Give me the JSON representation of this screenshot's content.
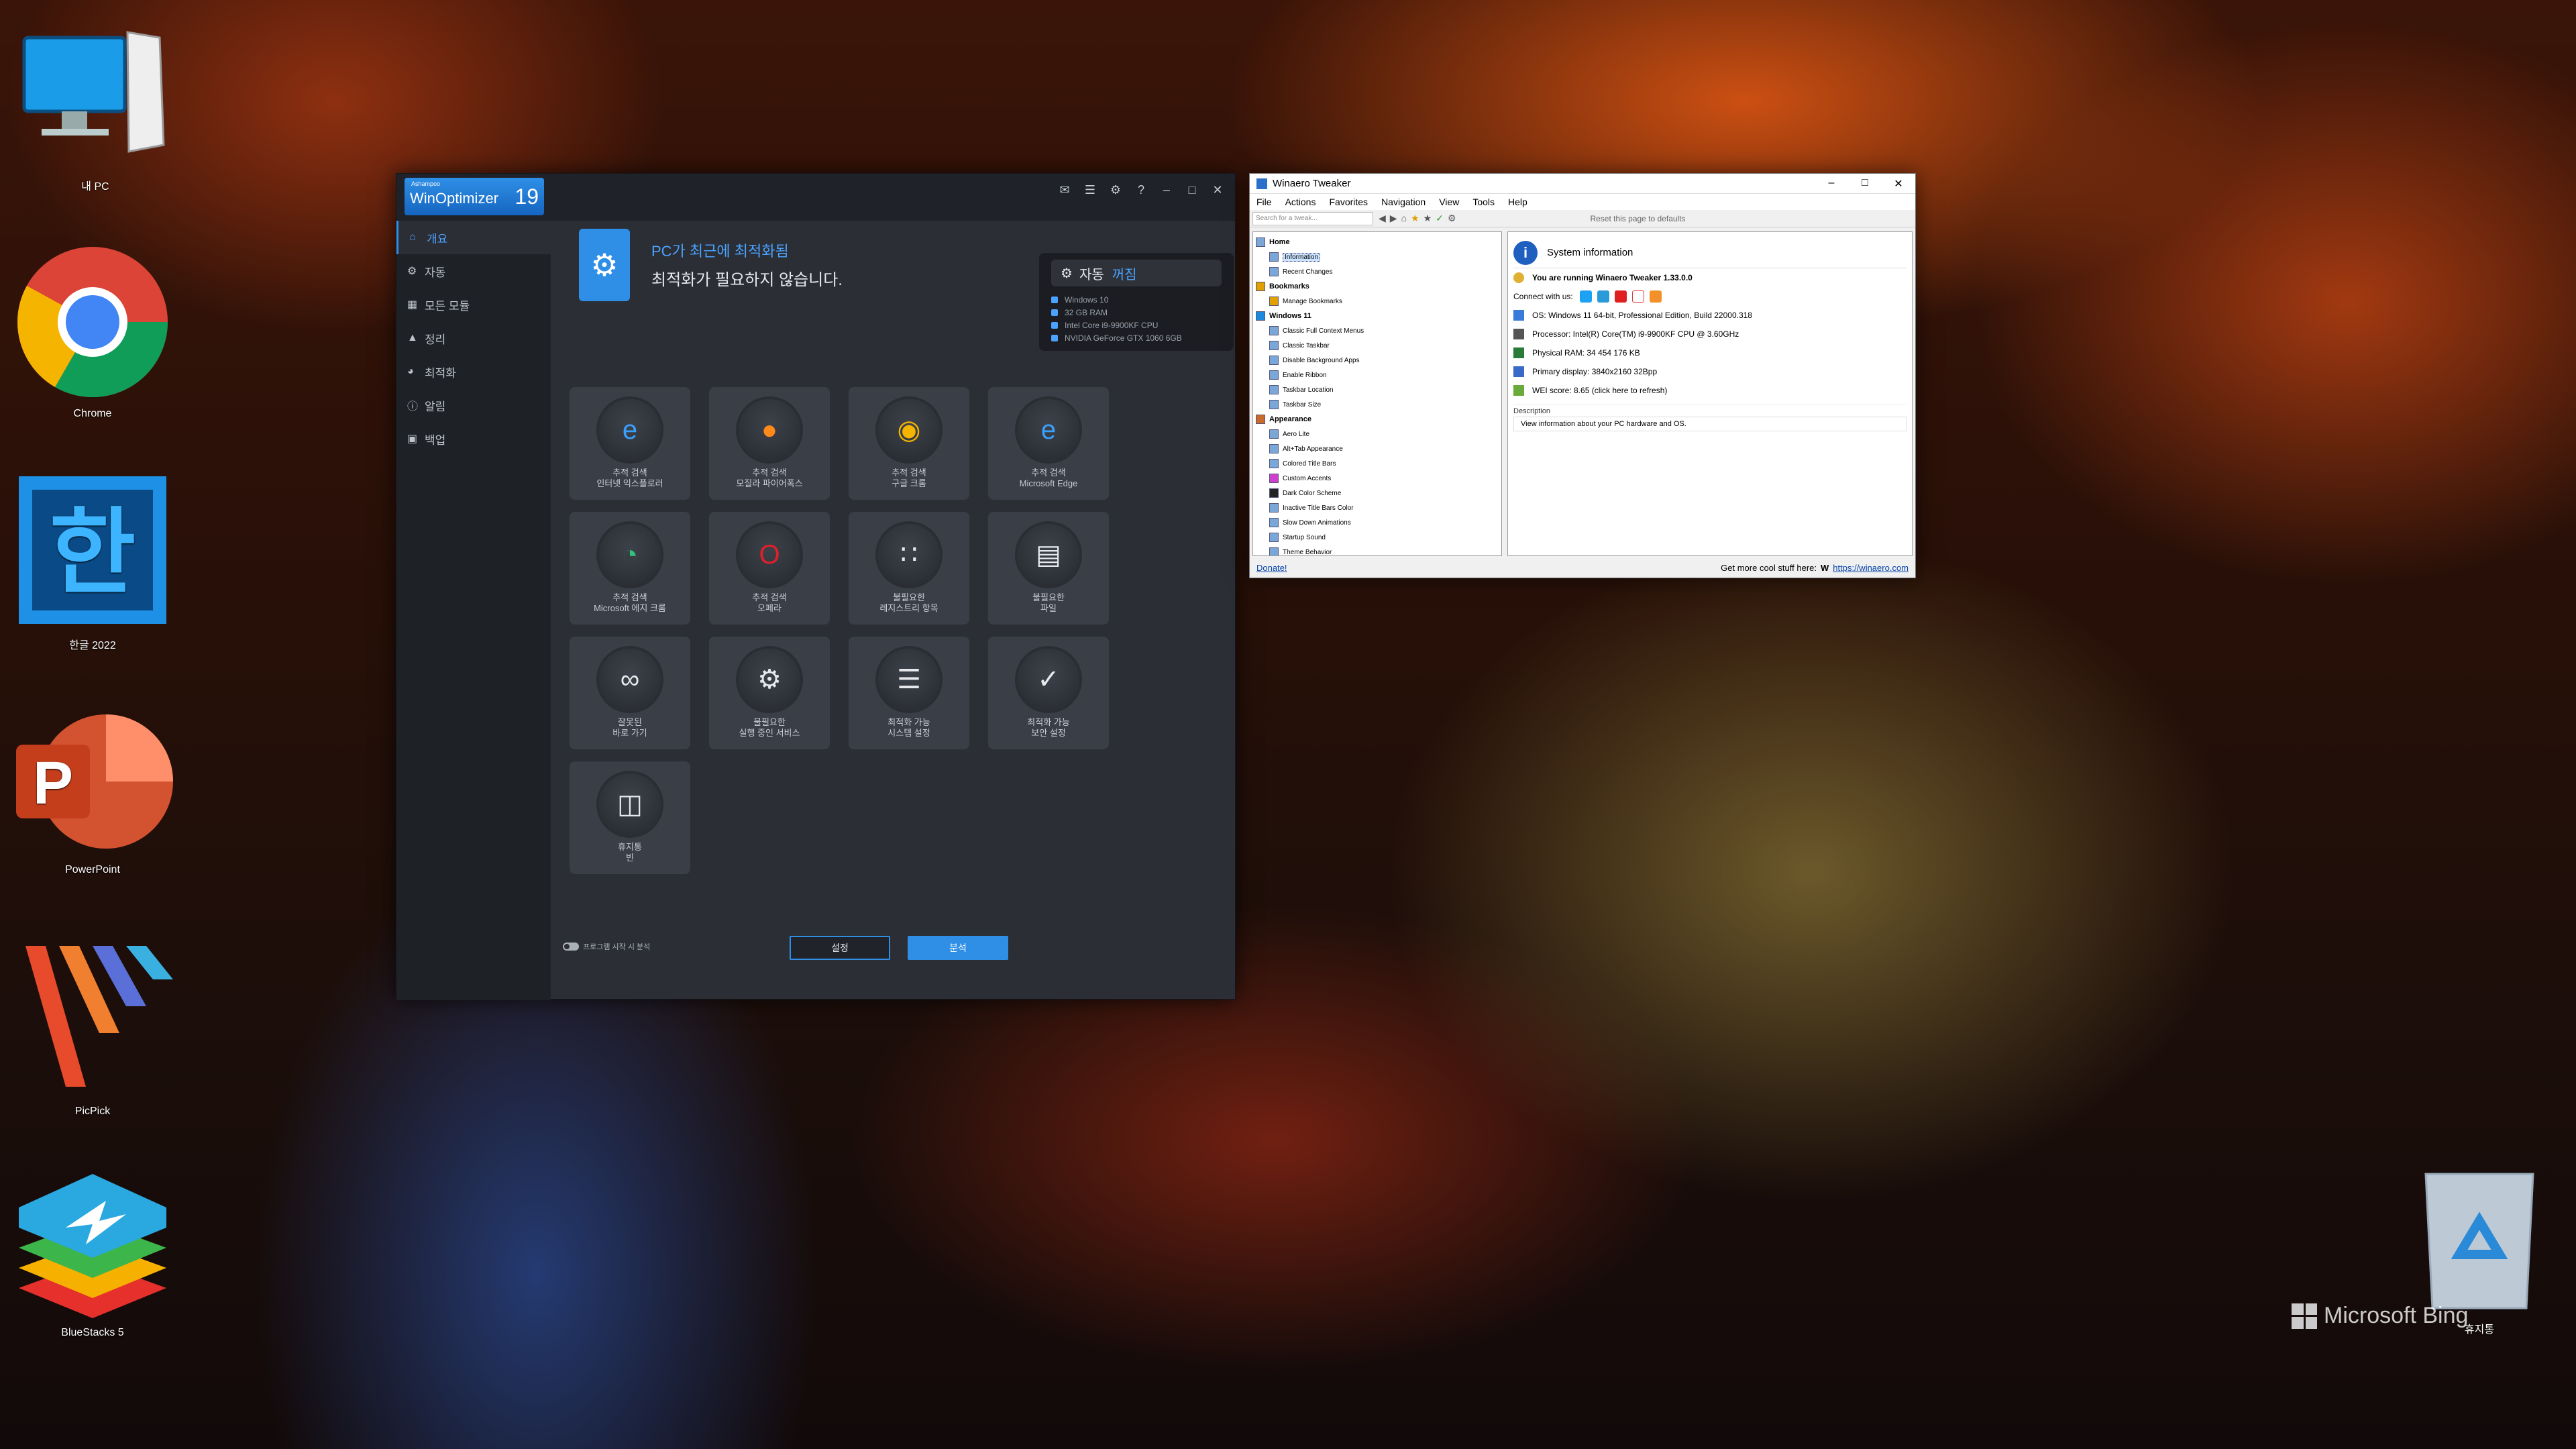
{
  "desktop": {
    "icons": [
      {
        "label": "내 PC",
        "icon": "computer-icon"
      },
      {
        "label": "Chrome",
        "icon": "chrome-icon"
      },
      {
        "label": "한글 2022",
        "icon": "hangul-icon"
      },
      {
        "label": "PowerPoint",
        "icon": "powerpoint-icon"
      },
      {
        "label": "PicPick",
        "icon": "picpick-icon"
      },
      {
        "label": "BlueStacks 5",
        "icon": "bluestacks-icon"
      }
    ],
    "recycle_bin_label": "휴지통",
    "bing_label": "Microsoft Bing"
  },
  "winoptimizer": {
    "brand_small": "Ashampoo",
    "brand": "WinOptimizer",
    "version": "19",
    "nav": [
      {
        "label": "개요",
        "icon": "home-icon",
        "active": true
      },
      {
        "label": "자동",
        "icon": "gears-icon"
      },
      {
        "label": "모든 모듈",
        "icon": "grid-icon"
      },
      {
        "label": "정리",
        "icon": "broom-icon"
      },
      {
        "label": "최적화",
        "icon": "speedometer-icon"
      },
      {
        "label": "알림",
        "icon": "info-icon"
      },
      {
        "label": "백업",
        "icon": "backup-icon"
      }
    ],
    "header": {
      "status_line": "PC가 최근에 최적화됨",
      "message": "최적화가 필요하지 않습니다."
    },
    "sys_panel": {
      "auto_label": "자동",
      "auto_state": "꺼짐",
      "items": [
        "Windows 10",
        "32 GB RAM",
        "Intel Core i9-9900KF CPU",
        "NVIDIA GeForce GTX 1060 6GB"
      ]
    },
    "tiles": [
      {
        "l1": "추적 검색",
        "l2": "인터넷 익스플로러",
        "icon": "ie-icon"
      },
      {
        "l1": "추적 검색",
        "l2": "모질라 파이어폭스",
        "icon": "firefox-icon"
      },
      {
        "l1": "추적 검색",
        "l2": "구글 크롬",
        "icon": "chrome-icon"
      },
      {
        "l1": "추적 검색",
        "l2": "Microsoft Edge",
        "icon": "edge-legacy-icon"
      },
      {
        "l1": "추적 검색",
        "l2": "Microsoft 에지 크롬",
        "icon": "edge-icon"
      },
      {
        "l1": "추적 검색",
        "l2": "오페라",
        "icon": "opera-icon"
      },
      {
        "l1": "불필요한",
        "l2": "레지스트리 항목",
        "icon": "registry-icon"
      },
      {
        "l1": "불필요한",
        "l2": "파일",
        "icon": "file-icon"
      },
      {
        "l1": "잘못된",
        "l2": "바로 가기",
        "icon": "link-icon"
      },
      {
        "l1": "불필요한",
        "l2": "실행 중인 서비스",
        "icon": "services-icon"
      },
      {
        "l1": "최적화 가능",
        "l2": "시스템 설정",
        "icon": "sliders-icon"
      },
      {
        "l1": "최적화 가능",
        "l2": "보안 설정",
        "icon": "shield-icon"
      },
      {
        "l1": "휴지통",
        "l2": "빈",
        "icon": "trash-icon"
      }
    ],
    "footer_toggle_label": "프로그램 시작 시 분석",
    "btn_settings": "설정",
    "btn_analyze": "분석"
  },
  "tweaker": {
    "title": "Winaero Tweaker",
    "menu": [
      "File",
      "Actions",
      "Favorites",
      "Navigation",
      "View",
      "Tools",
      "Help"
    ],
    "search_placeholder": "Search for a tweak...",
    "reset_label": "Reset this page to defaults",
    "tree": [
      {
        "label": "Home",
        "cat": true
      },
      {
        "label": "Information",
        "sel": true
      },
      {
        "label": "Recent Changes"
      },
      {
        "label": "Bookmarks",
        "cat": true
      },
      {
        "label": "Manage Bookmarks"
      },
      {
        "label": "Windows 11",
        "cat": true
      },
      {
        "label": "Classic Full Context Menus"
      },
      {
        "label": "Classic Taskbar"
      },
      {
        "label": "Disable Background Apps"
      },
      {
        "label": "Enable Ribbon"
      },
      {
        "label": "Taskbar Location"
      },
      {
        "label": "Taskbar Size"
      },
      {
        "label": "Appearance",
        "cat": true
      },
      {
        "label": "Aero Lite"
      },
      {
        "label": "Alt+Tab Appearance"
      },
      {
        "label": "Colored Title Bars"
      },
      {
        "label": "Custom Accents"
      },
      {
        "label": "Dark Color Scheme"
      },
      {
        "label": "Inactive Title Bars Color"
      },
      {
        "label": "Slow Down Animations"
      },
      {
        "label": "Startup Sound"
      },
      {
        "label": "Theme Behavior"
      }
    ],
    "detail": {
      "heading": "System information",
      "running": "You are running Winaero Tweaker 1.33.0.0",
      "connect": "Connect with us:",
      "os": "OS: Windows 11 64-bit, Professional Edition, Build 22000.318",
      "cpu": "Processor: Intel(R) Core(TM) i9-9900KF CPU @ 3.60GHz",
      "ram": "Physical RAM: 34 454 176 KB",
      "display": "Primary display: 3840x2160 32Bpp",
      "wei": "WEI score: 8.65 (click here to refresh)",
      "desc_label": "Description",
      "desc": "View information about your PC hardware and OS."
    },
    "status_donate": "Donate!",
    "status_text": "Get more cool stuff here:",
    "status_url": "https://winaero.com"
  }
}
